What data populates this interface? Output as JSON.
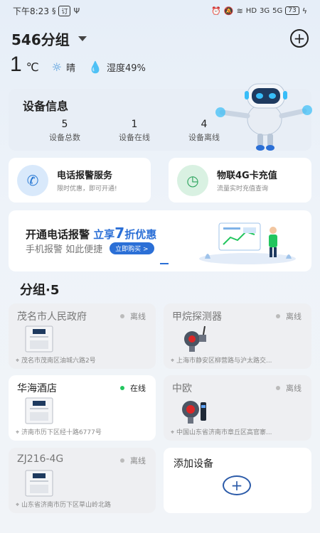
{
  "status_bar": {
    "time": "下午8:23",
    "network": "HD",
    "signal_a": "3G",
    "signal_b": "5G",
    "battery": "73"
  },
  "header": {
    "group_name": "546分组"
  },
  "weather": {
    "temperature": "1",
    "unit": "℃",
    "condition": "晴",
    "humidity": "湿度49%"
  },
  "device_info": {
    "title": "设备信息",
    "stats": [
      {
        "value": "5",
        "label": "设备总数"
      },
      {
        "value": "1",
        "label": "设备在线"
      },
      {
        "value": "4",
        "label": "设备离线"
      }
    ]
  },
  "services": [
    {
      "title": "电话报警服务",
      "subtitle": "限时优惠，即可开通!"
    },
    {
      "title": "物联4G卡充值",
      "subtitle": "流量实时充值查询"
    }
  ],
  "banner": {
    "line1_a": "开通电话报警",
    "line1_b": "立享",
    "line1_c": "7",
    "line1_d": "折优惠",
    "line2": "手机报警 如此便捷",
    "button": "立即购买 >"
  },
  "groups_title": "分组·5",
  "devices": [
    {
      "name": "茂名市人民政府",
      "status": "离线",
      "address": "茂名市茂南区油城六路2号"
    },
    {
      "name": "甲烷探测器",
      "status": "离线",
      "address": "上海市静安区柳营路与沪太路交..."
    },
    {
      "name": "华海酒店",
      "status": "在线",
      "address": "济南市历下区经十路6777号"
    },
    {
      "name": "中欧",
      "status": "离线",
      "address": "中国山东省济南市章丘区高官寨..."
    },
    {
      "name": "ZJ216-4G",
      "status": "离线",
      "address": "山东省济南市历下区草山岭北路"
    }
  ],
  "add_device": {
    "title": "添加设备"
  },
  "colors": {
    "accent": "#2b6fd6",
    "online": "#22c55e",
    "offline": "#bbbbbb"
  }
}
